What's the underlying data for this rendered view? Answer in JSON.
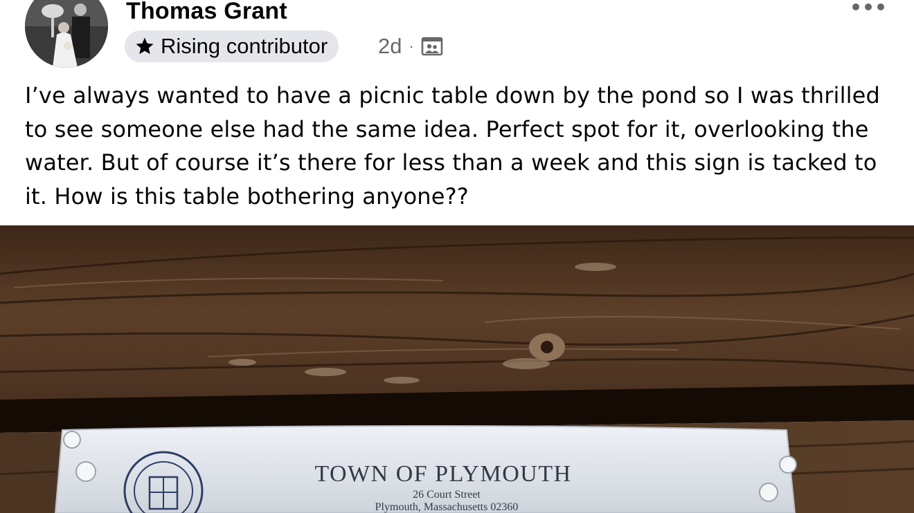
{
  "post": {
    "author": "Thomas Grant",
    "badge_label": "Rising contributor",
    "time_ago": "2d",
    "separator": "·",
    "audience_icon": "group-icon",
    "text": "I’ve always wanted to have a picnic table down by the pond so I was thrilled to see someone else had the same idea. Perfect spot for it, overlooking the water. But of course it’s there for less than a week and this sign is tacked to it. How is this table bothering anyone??"
  },
  "photo": {
    "sign_title": "TOWN OF PLYMOUTH",
    "sign_address_1": "26 Court Street",
    "sign_address_2": "Plymouth, Massachusetts 02360"
  },
  "colors": {
    "badge_bg": "#e4e6eb",
    "meta_text": "#65676b",
    "wood_dark": "#3b2616",
    "wood_mid": "#5e4129",
    "paper": "#dfe3ea"
  }
}
